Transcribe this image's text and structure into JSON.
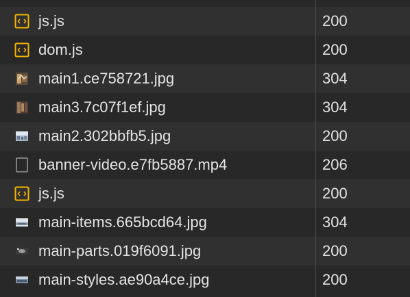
{
  "requests": [
    {
      "name": "",
      "status": "",
      "icon": "partial"
    },
    {
      "name": "js.js",
      "status": "200",
      "icon": "script-file-icon"
    },
    {
      "name": "dom.js",
      "status": "200",
      "icon": "script-file-icon"
    },
    {
      "name": "main1.ce758721.jpg",
      "status": "304",
      "icon": "image-thumbnail-icon"
    },
    {
      "name": "main3.7c07f1ef.jpg",
      "status": "304",
      "icon": "image-thumbnail-icon"
    },
    {
      "name": "main2.302bbfb5.jpg",
      "status": "200",
      "icon": "image-thumbnail-icon"
    },
    {
      "name": "banner-video.e7fb5887.mp4",
      "status": "206",
      "icon": "media-file-icon"
    },
    {
      "name": "js.js",
      "status": "200",
      "icon": "script-file-icon"
    },
    {
      "name": "main-items.665bcd64.jpg",
      "status": "304",
      "icon": "image-thumbnail-icon"
    },
    {
      "name": "main-parts.019f6091.jpg",
      "status": "200",
      "icon": "image-thumbnail-icon"
    },
    {
      "name": "main-styles.ae90a4ce.jpg",
      "status": "200",
      "icon": "image-thumbnail-icon"
    }
  ],
  "colors": {
    "script_icon": "#f4b400",
    "text": "#e3e3e3",
    "divider": "#4a4a4a"
  }
}
